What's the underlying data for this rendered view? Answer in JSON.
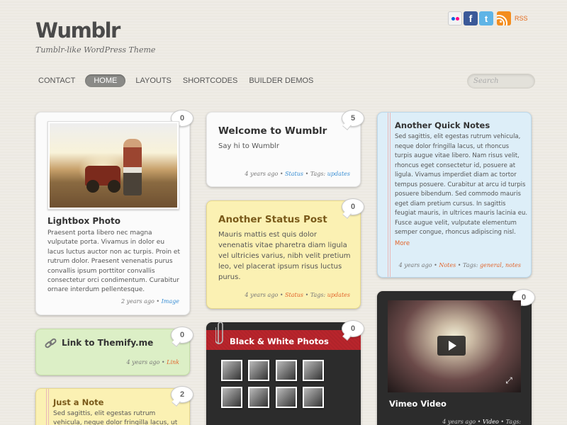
{
  "site": {
    "logo": "Wumblr",
    "tagline": "Tumblr-like WordPress Theme"
  },
  "social": {
    "flickr": "flickr-icon",
    "facebook": "f",
    "twitter": "t",
    "rss_label": "RSS"
  },
  "nav": {
    "items": [
      "CONTACT",
      "HOME",
      "LAYOUTS",
      "SHORTCODES",
      "BUILDER DEMOS"
    ],
    "active": "HOME"
  },
  "search": {
    "placeholder": "Search"
  },
  "posts": {
    "lightbox": {
      "title": "Lightbox Photo",
      "comments": "0",
      "text": "Praesent porta libero nec magna vulputate porta. Vivamus in dolor eu lacus luctus auctor non ac turpis. Proin et rutrum dolor. Praesent venenatis purus convallis ipsum porttitor convallis consectetur orci condimentum. Curabitur ornare interdum pellentesque.",
      "age": "2 years ago",
      "sep": "•",
      "category": "Image"
    },
    "link": {
      "title": "Link to Themify.me",
      "comments": "0",
      "age": "4 years ago",
      "sep": "•",
      "category": "Link"
    },
    "just_a_note": {
      "title": "Just a Note",
      "comments": "2",
      "text": "Sed sagittis, elit egestas rutrum vehicula, neque dolor fringilla lacus, ut rhoncus"
    },
    "welcome": {
      "title": "Welcome to Wumblr",
      "comments": "5",
      "text": "Say hi to Wumblr",
      "age": "4 years ago",
      "sep": "•",
      "category": "Status",
      "tags_label": "• Tags:",
      "tags": "updates"
    },
    "status": {
      "title": "Another Status Post",
      "comments": "0",
      "text": "Mauris mattis est quis dolor venenatis vitae pharetra diam ligula vel ultricies varius, nibh velit pretium leo, vel placerat ipsum risus luctus purus.",
      "age": "4 years ago",
      "sep": "•",
      "category": "Status",
      "tags_label": "• Tags:",
      "tags": "updates"
    },
    "bw_photos": {
      "title": "Black & White Photos",
      "comments": "0"
    },
    "quick_notes": {
      "title": "Another Quick Notes",
      "text": "Sed sagittis, elit egestas rutrum vehicula, neque dolor fringilla lacus, ut rhoncus turpis augue vitae libero. Nam risus velit, rhoncus eget consectetur id, posuere at ligula. Vivamus imperdiet diam ac tortor tempus posuere. Curabitur at arcu id turpis posuere bibendum. Sed commodo mauris eget diam pretium cursus. In sagittis feugiat mauris, in ultrices mauris lacinia eu. Fusce augue velit, vulputate elementum semper congue, rhoncus adipiscing nisl.",
      "more": "More",
      "age": "4 years ago",
      "sep": "•",
      "category": "Notes",
      "tags_label": "• Tags:",
      "tag1": "general",
      "tag_sep": ",",
      "tag2": "notes"
    },
    "vimeo": {
      "title": "Vimeo Video",
      "comments": "0",
      "age": "4 years ago",
      "sep": "•",
      "category": "Video",
      "tags_label": "• Tags:"
    }
  },
  "colors": {
    "accent_orange": "#e2652c",
    "accent_blue": "#3a8fd4",
    "nav_active": "#8a8a87",
    "photo_band": "#b9252c"
  }
}
